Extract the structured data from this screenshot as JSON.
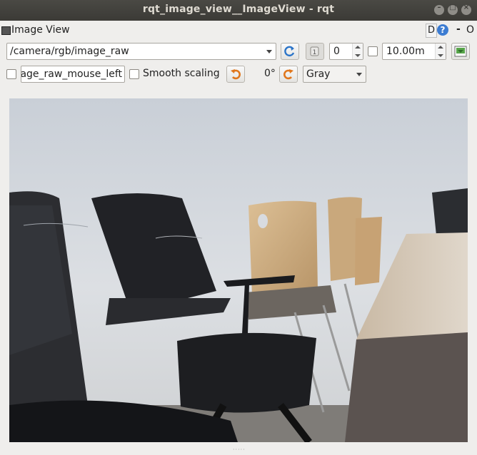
{
  "window": {
    "title": "rqt_image_view__ImageView - rqt"
  },
  "dock": {
    "title": "Image View",
    "d_label": "D",
    "help_label": "?",
    "minimize_label": "-",
    "close_label": "O"
  },
  "toolbar": {
    "topic": "/camera/rgb/image_raw",
    "number_value": "0",
    "timeout_value": "10.00m",
    "mouse_topic": "age_raw_mouse_left",
    "smooth_scaling_label": "Smooth scaling",
    "smooth_scaling_checked": false,
    "rotation_label": "0°",
    "colormap": "Gray"
  },
  "image": {
    "description_icon": "camera-frame-chairs"
  }
}
